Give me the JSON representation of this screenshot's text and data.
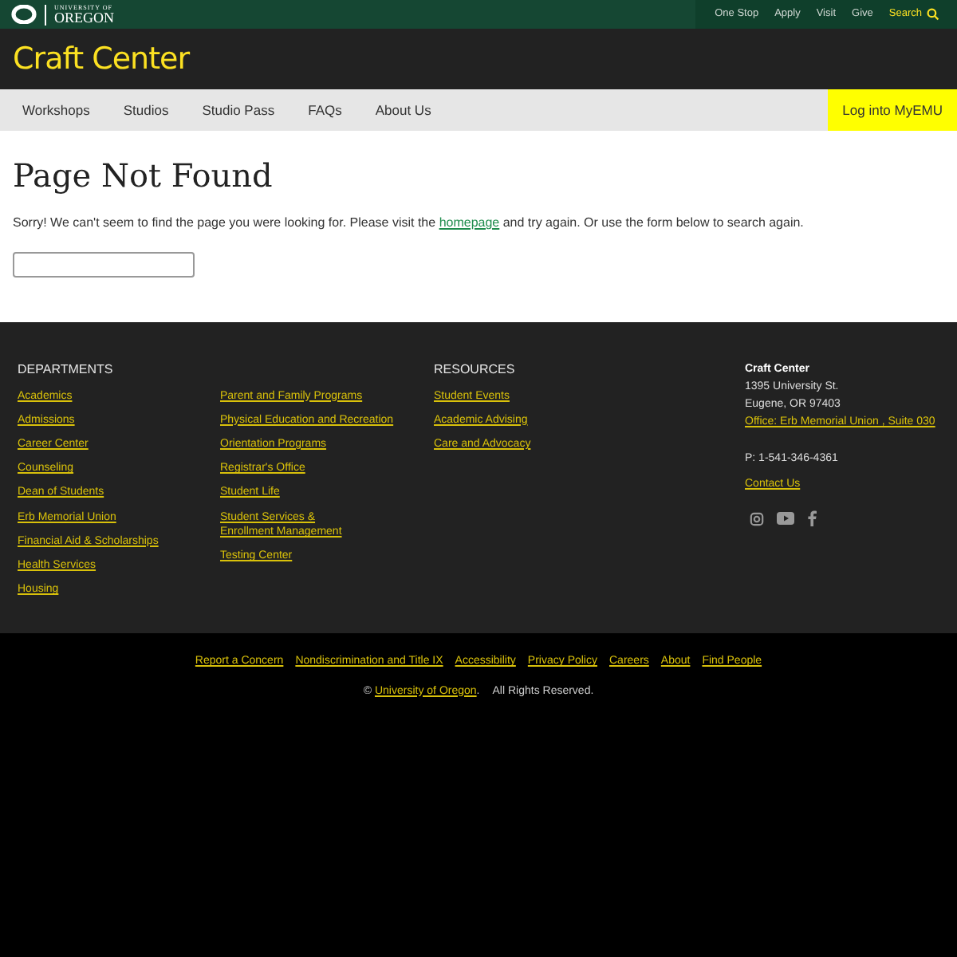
{
  "topbar": {
    "logo_small": "UNIVERSITY OF",
    "logo_big": "OREGON",
    "links": [
      "One Stop",
      "Apply",
      "Visit",
      "Give"
    ],
    "search": "Search"
  },
  "site_title": "Craft Center",
  "nav": {
    "items": [
      "Workshops",
      "Studios",
      "Studio Pass",
      "FAQs",
      "About Us"
    ],
    "login": "Log into MyEMU"
  },
  "main": {
    "heading": "Page Not Found",
    "before": "Sorry! We can't seem to find the page you were looking for. Please visit the",
    "link": "homepage",
    "after": "and try again. Or use the form below to search again."
  },
  "footer": {
    "departments": {
      "heading": "DEPARTMENTS",
      "columns": [
        [
          "Academics",
          "Admissions",
          "Career Center",
          "Counseling",
          "Dean of Students",
          "Erb Memorial Union",
          "Financial Aid & Scholarships",
          "Health Services",
          "Housing"
        ],
        [
          "Parent and Family Programs",
          "Physical Education and Recreation",
          "Orientation Programs",
          "Registrar's Office",
          "Student Life",
          "Student Services &\nEnrollment Management",
          "Testing Center"
        ]
      ]
    },
    "resources": {
      "heading": "RESOURCES",
      "links": [
        "Student Events",
        "Academic Advising",
        "Care and Advocacy"
      ]
    },
    "contact": {
      "name": "Craft Center",
      "street": "1395 University St.",
      "city": "Eugene, OR 97403",
      "office": "Office: Erb Memorial Union , Suite 030",
      "phone": "P: 1-541-346-4361",
      "contact_link": "Contact Us"
    }
  },
  "bottom": {
    "links": [
      "Report a Concern",
      "Nondiscrimination and Title IX",
      "Accessibility",
      "Privacy Policy",
      "Careers",
      "About",
      "Find People"
    ],
    "copyright": "©",
    "org": "University of Oregon",
    "dot": ".",
    "rights": "All Rights Reserved."
  }
}
